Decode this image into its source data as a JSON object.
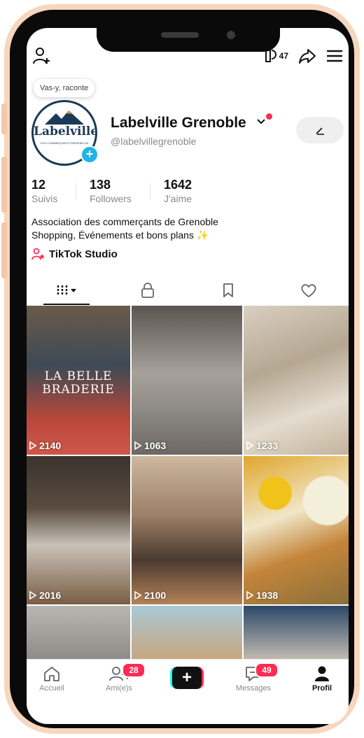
{
  "header": {
    "notifications_count": "47",
    "icons": [
      "add-friend-icon",
      "gift-icon",
      "share-icon",
      "menu-icon"
    ]
  },
  "profile": {
    "prompt_bubble": "Vas-y, raconte",
    "avatar_text": "Labelville",
    "avatar_subtext": "VOS COMMERÇANTS GRENOBLOIS",
    "name": "Labelville Grenoble",
    "handle": "@labelvillegrenoble",
    "stats": [
      {
        "value": "12",
        "label": "Suivis"
      },
      {
        "value": "138",
        "label": "Followers"
      },
      {
        "value": "1642",
        "label": "J'aime"
      }
    ],
    "bio_line1": "Association des commerçants de Grenoble",
    "bio_line2": "Shopping, Événements et bons plans ✨",
    "studio_label": "TikTok Studio"
  },
  "tabs": [
    "videos-tab",
    "private-tab",
    "saved-tab",
    "liked-tab"
  ],
  "videos": [
    {
      "views": "2140",
      "title": "LA BELLE BRADERIE",
      "color": "#8c4a3c"
    },
    {
      "views": "1063",
      "title": "",
      "color": "#8d8a86"
    },
    {
      "views": "1233",
      "title": "",
      "color": "#c7b9a4"
    },
    {
      "views": "2016",
      "title": "",
      "color": "#6e665f"
    },
    {
      "views": "2100",
      "title": "",
      "color": "#a58468"
    },
    {
      "views": "1938",
      "title": "",
      "color": "#d8b24a"
    },
    {
      "views": "",
      "title": "",
      "color": "#b3b0aa"
    },
    {
      "views": "",
      "title": "",
      "color": "#c9a57a"
    },
    {
      "views": "",
      "title": "",
      "color": "#5d6e86"
    }
  ],
  "nav": {
    "home": "Accueil",
    "friends": "Ami(e)s",
    "friends_badge": "28",
    "messages": "Messages",
    "messages_badge": "49",
    "profile": "Profil"
  },
  "colors": {
    "accent": "#fe2c55",
    "cyan": "#25f4ee",
    "badge_blue": "#20b4e8"
  }
}
